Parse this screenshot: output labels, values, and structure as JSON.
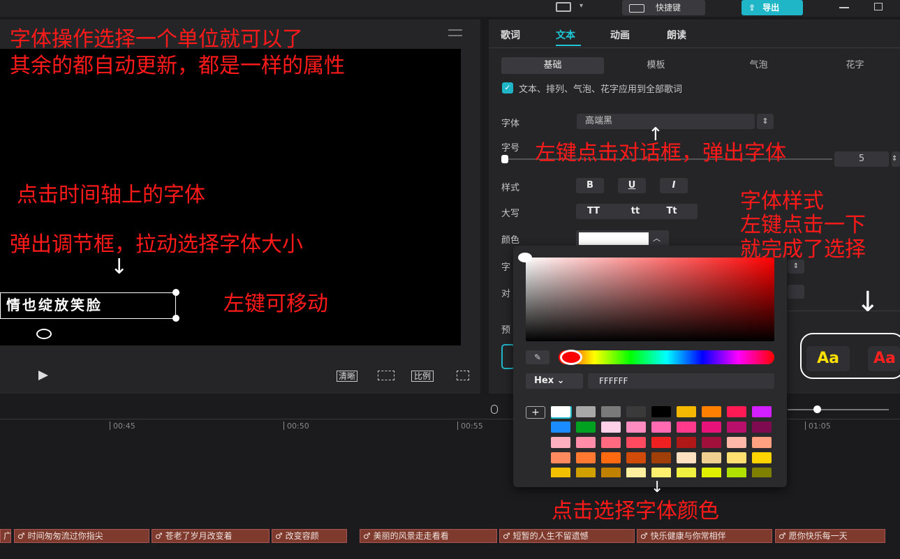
{
  "topbar": {
    "shortcut_label": "快捷键",
    "export_label": "导出"
  },
  "preview": {
    "lyric_text": "情也绽放笑脸",
    "controls": {
      "clear": "清晰",
      "ratio": "比例"
    }
  },
  "right_panel": {
    "tabs": [
      "歌词",
      "文本",
      "动画",
      "朗读"
    ],
    "subtabs": [
      "基础",
      "模板",
      "气泡",
      "花字"
    ],
    "apply_all_label": "文本、排列、气泡、花字应用到全部歌词",
    "font_label": "字体",
    "font_value": "高端黑",
    "size_label": "字号",
    "size_value": "5",
    "style_label": "样式",
    "style_buttons": [
      "B",
      "U",
      "I"
    ],
    "case_label": "大写",
    "case_buttons": [
      "TT",
      "tt",
      "Tt"
    ],
    "color_label": "颜色",
    "partial_labels": [
      "字",
      "对",
      "预"
    ],
    "preset_samples": [
      "Aa",
      "Aa"
    ]
  },
  "color_picker": {
    "hex_label": "Hex",
    "hex_value": "FFFFFF",
    "swatches": [
      "#ffffff",
      "#a8a8a8",
      "#7a7a7a",
      "#3a3a3a",
      "#000000",
      "#f5b800",
      "#ff7f00",
      "#ff1a55",
      "#d21fff",
      "#1a8cff",
      "#00a020",
      "#ffd0e8",
      "#ff8cc0",
      "#ff6ab0",
      "#ff3a8c",
      "#e6127a",
      "#b8106a",
      "#7e0a50",
      "#ffb0c0",
      "#ff8ca8",
      "#ff6a80",
      "#ff4a60",
      "#ee2020",
      "#b01818",
      "#a0103a",
      "#ffb8a8",
      "#ffa080",
      "#ff8a60",
      "#ff7a30",
      "#ff6a10",
      "#d04a08",
      "#a04008",
      "#ffe0c0",
      "#f0d090",
      "#ffe070",
      "#ffd400",
      "#f0c000",
      "#d0a000",
      "#c08000",
      "#fff0a0",
      "#fff070",
      "#f0f040",
      "#e0f000",
      "#b0e000",
      "#808000",
      "#607000",
      "#b0f0a0",
      "#80f080",
      "#20e020"
    ]
  },
  "timeline": {
    "ticks": [
      "00:45",
      "00:50",
      "00:55",
      "01:05"
    ],
    "clips": [
      "广",
      "时间匆匆流过你指尖",
      "苍老了岁月改变着",
      "改变容颜",
      "美丽的风景走走看看",
      "短暂的人生不留遗憾",
      "快乐健康与你常相伴",
      "愿你快乐每一天"
    ]
  },
  "annotations": {
    "a1_line1": "字体操作选择一个单位就可以了",
    "a1_line2": "其余的都自动更新，都是一样的属性",
    "a2": "点击时间轴上的字体",
    "a3": "弹出调节框，拉动选择字体大小",
    "a4": "左键可移动",
    "a5": "左键点击对话框，弹出字体",
    "a6_line1": "字体样式",
    "a6_line2": "左键点击一下",
    "a6_line3": "就完成了选择",
    "a7": "点击选择字体颜色"
  },
  "colors": {
    "accent": "#1fb6c7",
    "annotation": "#ff1a1a",
    "clip": "#7e3a2c"
  }
}
